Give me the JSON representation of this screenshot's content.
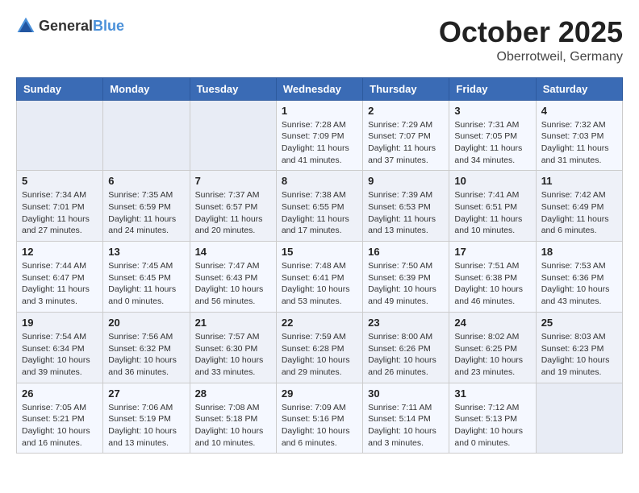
{
  "header": {
    "logo_general": "General",
    "logo_blue": "Blue",
    "month": "October 2025",
    "location": "Oberrotweil, Germany"
  },
  "weekdays": [
    "Sunday",
    "Monday",
    "Tuesday",
    "Wednesday",
    "Thursday",
    "Friday",
    "Saturday"
  ],
  "weeks": [
    [
      {
        "day": "",
        "info": ""
      },
      {
        "day": "",
        "info": ""
      },
      {
        "day": "",
        "info": ""
      },
      {
        "day": "1",
        "info": "Sunrise: 7:28 AM\nSunset: 7:09 PM\nDaylight: 11 hours\nand 41 minutes."
      },
      {
        "day": "2",
        "info": "Sunrise: 7:29 AM\nSunset: 7:07 PM\nDaylight: 11 hours\nand 37 minutes."
      },
      {
        "day": "3",
        "info": "Sunrise: 7:31 AM\nSunset: 7:05 PM\nDaylight: 11 hours\nand 34 minutes."
      },
      {
        "day": "4",
        "info": "Sunrise: 7:32 AM\nSunset: 7:03 PM\nDaylight: 11 hours\nand 31 minutes."
      }
    ],
    [
      {
        "day": "5",
        "info": "Sunrise: 7:34 AM\nSunset: 7:01 PM\nDaylight: 11 hours\nand 27 minutes."
      },
      {
        "day": "6",
        "info": "Sunrise: 7:35 AM\nSunset: 6:59 PM\nDaylight: 11 hours\nand 24 minutes."
      },
      {
        "day": "7",
        "info": "Sunrise: 7:37 AM\nSunset: 6:57 PM\nDaylight: 11 hours\nand 20 minutes."
      },
      {
        "day": "8",
        "info": "Sunrise: 7:38 AM\nSunset: 6:55 PM\nDaylight: 11 hours\nand 17 minutes."
      },
      {
        "day": "9",
        "info": "Sunrise: 7:39 AM\nSunset: 6:53 PM\nDaylight: 11 hours\nand 13 minutes."
      },
      {
        "day": "10",
        "info": "Sunrise: 7:41 AM\nSunset: 6:51 PM\nDaylight: 11 hours\nand 10 minutes."
      },
      {
        "day": "11",
        "info": "Sunrise: 7:42 AM\nSunset: 6:49 PM\nDaylight: 11 hours\nand 6 minutes."
      }
    ],
    [
      {
        "day": "12",
        "info": "Sunrise: 7:44 AM\nSunset: 6:47 PM\nDaylight: 11 hours\nand 3 minutes."
      },
      {
        "day": "13",
        "info": "Sunrise: 7:45 AM\nSunset: 6:45 PM\nDaylight: 11 hours\nand 0 minutes."
      },
      {
        "day": "14",
        "info": "Sunrise: 7:47 AM\nSunset: 6:43 PM\nDaylight: 10 hours\nand 56 minutes."
      },
      {
        "day": "15",
        "info": "Sunrise: 7:48 AM\nSunset: 6:41 PM\nDaylight: 10 hours\nand 53 minutes."
      },
      {
        "day": "16",
        "info": "Sunrise: 7:50 AM\nSunset: 6:39 PM\nDaylight: 10 hours\nand 49 minutes."
      },
      {
        "day": "17",
        "info": "Sunrise: 7:51 AM\nSunset: 6:38 PM\nDaylight: 10 hours\nand 46 minutes."
      },
      {
        "day": "18",
        "info": "Sunrise: 7:53 AM\nSunset: 6:36 PM\nDaylight: 10 hours\nand 43 minutes."
      }
    ],
    [
      {
        "day": "19",
        "info": "Sunrise: 7:54 AM\nSunset: 6:34 PM\nDaylight: 10 hours\nand 39 minutes."
      },
      {
        "day": "20",
        "info": "Sunrise: 7:56 AM\nSunset: 6:32 PM\nDaylight: 10 hours\nand 36 minutes."
      },
      {
        "day": "21",
        "info": "Sunrise: 7:57 AM\nSunset: 6:30 PM\nDaylight: 10 hours\nand 33 minutes."
      },
      {
        "day": "22",
        "info": "Sunrise: 7:59 AM\nSunset: 6:28 PM\nDaylight: 10 hours\nand 29 minutes."
      },
      {
        "day": "23",
        "info": "Sunrise: 8:00 AM\nSunset: 6:26 PM\nDaylight: 10 hours\nand 26 minutes."
      },
      {
        "day": "24",
        "info": "Sunrise: 8:02 AM\nSunset: 6:25 PM\nDaylight: 10 hours\nand 23 minutes."
      },
      {
        "day": "25",
        "info": "Sunrise: 8:03 AM\nSunset: 6:23 PM\nDaylight: 10 hours\nand 19 minutes."
      }
    ],
    [
      {
        "day": "26",
        "info": "Sunrise: 7:05 AM\nSunset: 5:21 PM\nDaylight: 10 hours\nand 16 minutes."
      },
      {
        "day": "27",
        "info": "Sunrise: 7:06 AM\nSunset: 5:19 PM\nDaylight: 10 hours\nand 13 minutes."
      },
      {
        "day": "28",
        "info": "Sunrise: 7:08 AM\nSunset: 5:18 PM\nDaylight: 10 hours\nand 10 minutes."
      },
      {
        "day": "29",
        "info": "Sunrise: 7:09 AM\nSunset: 5:16 PM\nDaylight: 10 hours\nand 6 minutes."
      },
      {
        "day": "30",
        "info": "Sunrise: 7:11 AM\nSunset: 5:14 PM\nDaylight: 10 hours\nand 3 minutes."
      },
      {
        "day": "31",
        "info": "Sunrise: 7:12 AM\nSunset: 5:13 PM\nDaylight: 10 hours\nand 0 minutes."
      },
      {
        "day": "",
        "info": ""
      }
    ]
  ]
}
